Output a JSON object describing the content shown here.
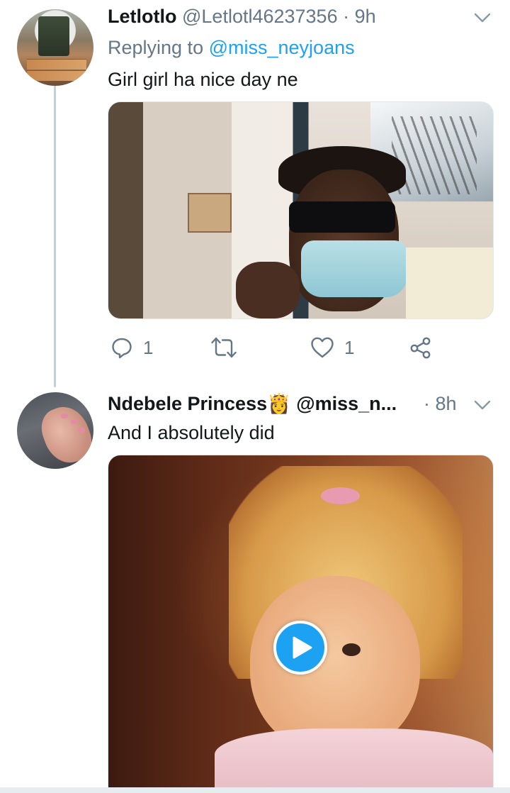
{
  "tweets": [
    {
      "name": "Letlotlo",
      "handle": "@Letlotl46237356",
      "separator": "·",
      "time": "9h",
      "reply_label": "Replying to",
      "reply_to": "@miss_neyjoans",
      "text": "Girl  girl ha nice  day  ne",
      "actions": {
        "reply_count": "1",
        "retweet_count": "",
        "like_count": "1"
      }
    },
    {
      "name": "Ndebele Princess",
      "name_emoji": "👸",
      "handle": "@miss_n...",
      "separator": "·",
      "time": "8h",
      "text": "And I absolutely did"
    }
  ],
  "colors": {
    "accent": "#1da1f2",
    "secondary_text": "#657786",
    "primary_text": "#14171a",
    "thread_line": "#c4cfd6"
  },
  "icons": [
    "chevron-down-icon",
    "reply-icon",
    "retweet-icon",
    "like-icon",
    "share-icon",
    "play-icon"
  ]
}
